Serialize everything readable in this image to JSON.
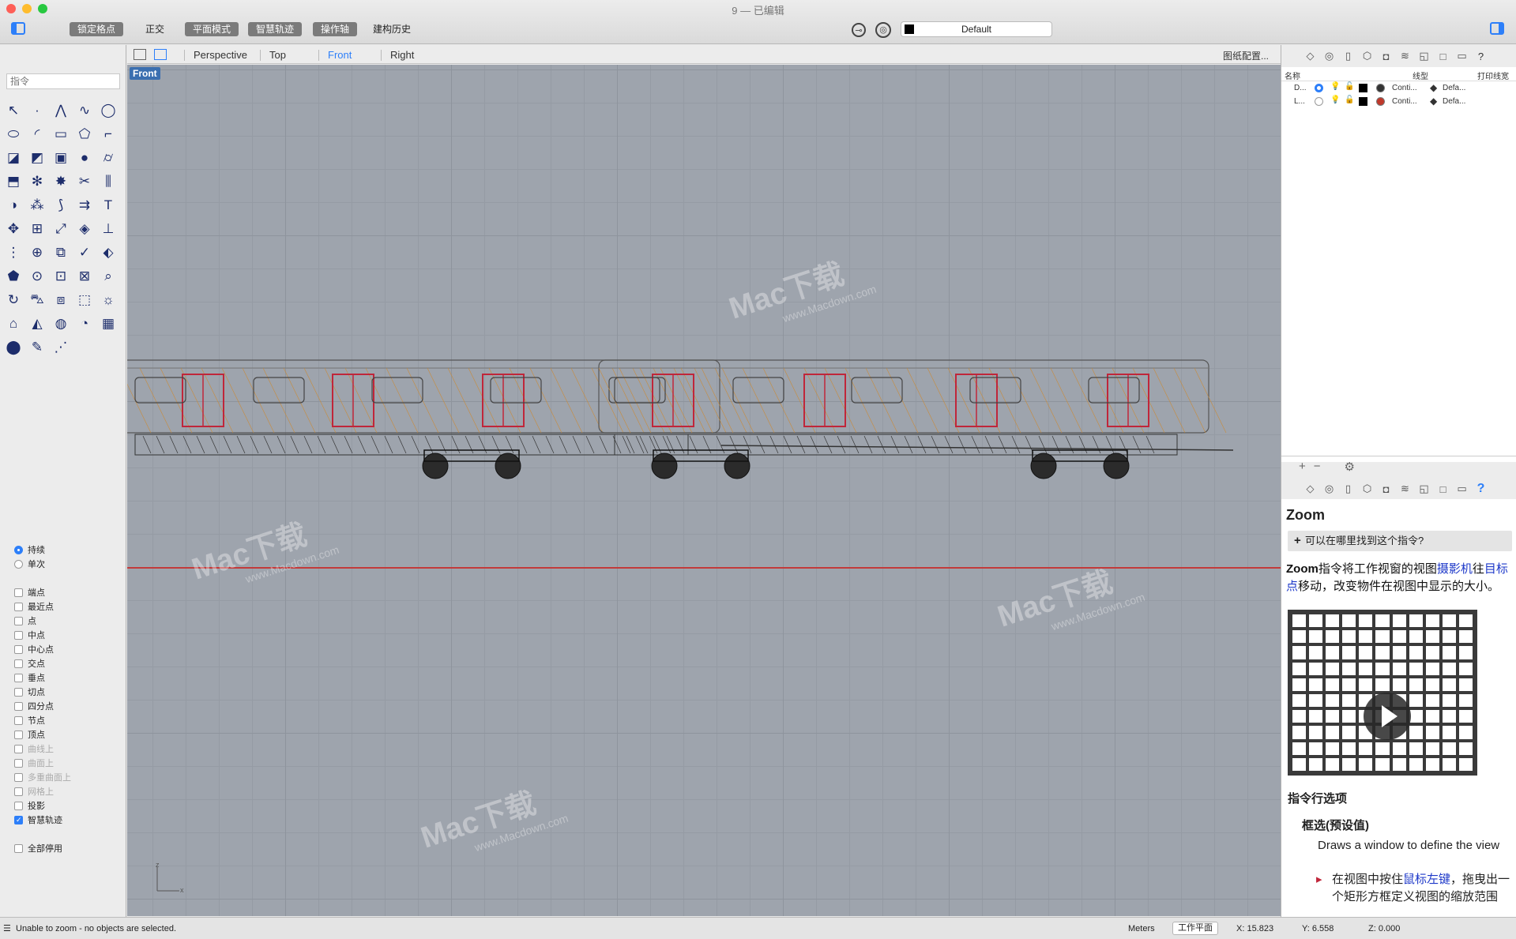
{
  "window": {
    "title": "9 — 已编辑"
  },
  "toolbar": {
    "modes": [
      {
        "label": "锁定格点",
        "on": true
      },
      {
        "label": "正交",
        "on": false
      },
      {
        "label": "平面模式",
        "on": true
      },
      {
        "label": "智慧轨迹",
        "on": true
      },
      {
        "label": "操作轴",
        "on": true
      },
      {
        "label": "建构历史",
        "on": false
      }
    ],
    "layer_name": "Default"
  },
  "left_panel": {
    "command_placeholder": "指令",
    "tools": [
      "arrow",
      "point",
      "polyline",
      "curve",
      "circle",
      "ellipse",
      "arc",
      "rectangle",
      "polygon",
      "fillet",
      "surface",
      "loft",
      "box",
      "sphere",
      "cylinder",
      "extrude",
      "gear",
      "explode",
      "trim",
      "split",
      "boolean",
      "group",
      "join",
      "offset",
      "text",
      "move",
      "array",
      "scale",
      "cube",
      "dimension",
      "grid",
      "gumball",
      "copy",
      "check",
      "lock",
      "paint",
      "zoom",
      "zoomwin",
      "zoomext",
      "search",
      "rotate",
      "car",
      "mesh",
      "transform",
      "light",
      "lock2",
      "render",
      "color",
      "display",
      "help",
      "ball",
      "pen",
      "points"
    ],
    "osnap": [
      {
        "label": "持续",
        "type": "radio",
        "checked": true,
        "disabled": false
      },
      {
        "label": "单次",
        "type": "radio",
        "checked": false,
        "disabled": false
      },
      {
        "label": "端点",
        "type": "check",
        "checked": false,
        "disabled": false,
        "gap": true
      },
      {
        "label": "最近点",
        "type": "check",
        "checked": false,
        "disabled": false
      },
      {
        "label": "点",
        "type": "check",
        "checked": false,
        "disabled": false
      },
      {
        "label": "中点",
        "type": "check",
        "checked": false,
        "disabled": false
      },
      {
        "label": "中心点",
        "type": "check",
        "checked": false,
        "disabled": false
      },
      {
        "label": "交点",
        "type": "check",
        "checked": false,
        "disabled": false
      },
      {
        "label": "垂点",
        "type": "check",
        "checked": false,
        "disabled": false
      },
      {
        "label": "切点",
        "type": "check",
        "checked": false,
        "disabled": false
      },
      {
        "label": "四分点",
        "type": "check",
        "checked": false,
        "disabled": false
      },
      {
        "label": "节点",
        "type": "check",
        "checked": false,
        "disabled": false
      },
      {
        "label": "顶点",
        "type": "check",
        "checked": false,
        "disabled": false
      },
      {
        "label": "曲线上",
        "type": "check",
        "checked": false,
        "disabled": true
      },
      {
        "label": "曲面上",
        "type": "check",
        "checked": false,
        "disabled": true
      },
      {
        "label": "多重曲面上",
        "type": "check",
        "checked": false,
        "disabled": true
      },
      {
        "label": "网格上",
        "type": "check",
        "checked": false,
        "disabled": true
      },
      {
        "label": "投影",
        "type": "check",
        "checked": false,
        "disabled": false
      },
      {
        "label": "智慧轨迹",
        "type": "check",
        "checked": true,
        "disabled": false
      },
      {
        "label": "全部停用",
        "type": "check",
        "checked": false,
        "disabled": false,
        "gap": true
      }
    ]
  },
  "viewport": {
    "tabs": [
      {
        "label": "Perspective",
        "active": false
      },
      {
        "label": "Top",
        "active": false
      },
      {
        "label": "Front",
        "active": true
      },
      {
        "label": "Right",
        "active": false
      }
    ],
    "paper_config": "图纸配置...",
    "label": "Front",
    "axis_x": "x",
    "axis_z": "z",
    "watermark_main": "Mac下载",
    "watermark_sub": "www.Macdown.com"
  },
  "layers": {
    "headers": {
      "name": "名称",
      "linetype": "线型",
      "printwidth": "打印线宽"
    },
    "rows": [
      {
        "name": "D...",
        "current": true,
        "linetype": "Conti...",
        "printwidth": "Defa..."
      },
      {
        "name": "L...",
        "current": false,
        "linetype": "Conti...",
        "printwidth": "Defa..."
      }
    ],
    "add": "+",
    "remove": "−",
    "settings": "⚙"
  },
  "help": {
    "title": "Zoom",
    "where": "可以在哪里找到这个指令?",
    "body_cmd": "Zoom",
    "body_1": "指令将工作视窗的视图",
    "body_link1": "摄影机",
    "body_2": "往",
    "body_link2": "目标点",
    "body_3": "移动，改变物件在视图中显示的大小。",
    "options_title": "指令行选项",
    "option_name": "框选(预设值)",
    "option_desc": "Draws a window to define the view",
    "bullet_1": "在视图中按住",
    "bullet_link": "鼠标左键",
    "bullet_2": "，拖曳出一个矩形方框定义视图的缩放范围"
  },
  "status": {
    "message": "Unable to zoom - no objects are selected.",
    "units": "Meters",
    "cplane": "工作平面",
    "x": "X: 15.823",
    "y": "Y: 6.558",
    "z": "Z: 0.000"
  },
  "colors": {
    "accent": "#2d7ff9",
    "x_axis": "#c23b3b",
    "viewport_bg": "#9ea4ad"
  }
}
